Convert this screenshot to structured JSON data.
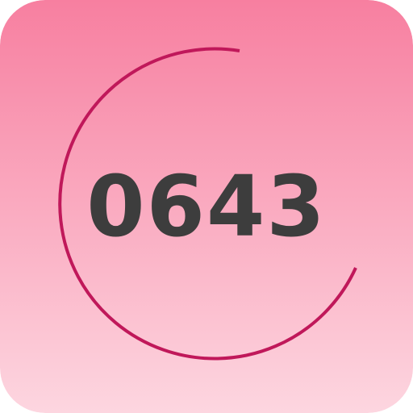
{
  "icon": {
    "code": "0643",
    "colors": {
      "gradient_top": "#f77fa0",
      "gradient_bottom": "#fdd6e0",
      "arc": "#c0185a",
      "text": "#3d3d3d"
    }
  }
}
